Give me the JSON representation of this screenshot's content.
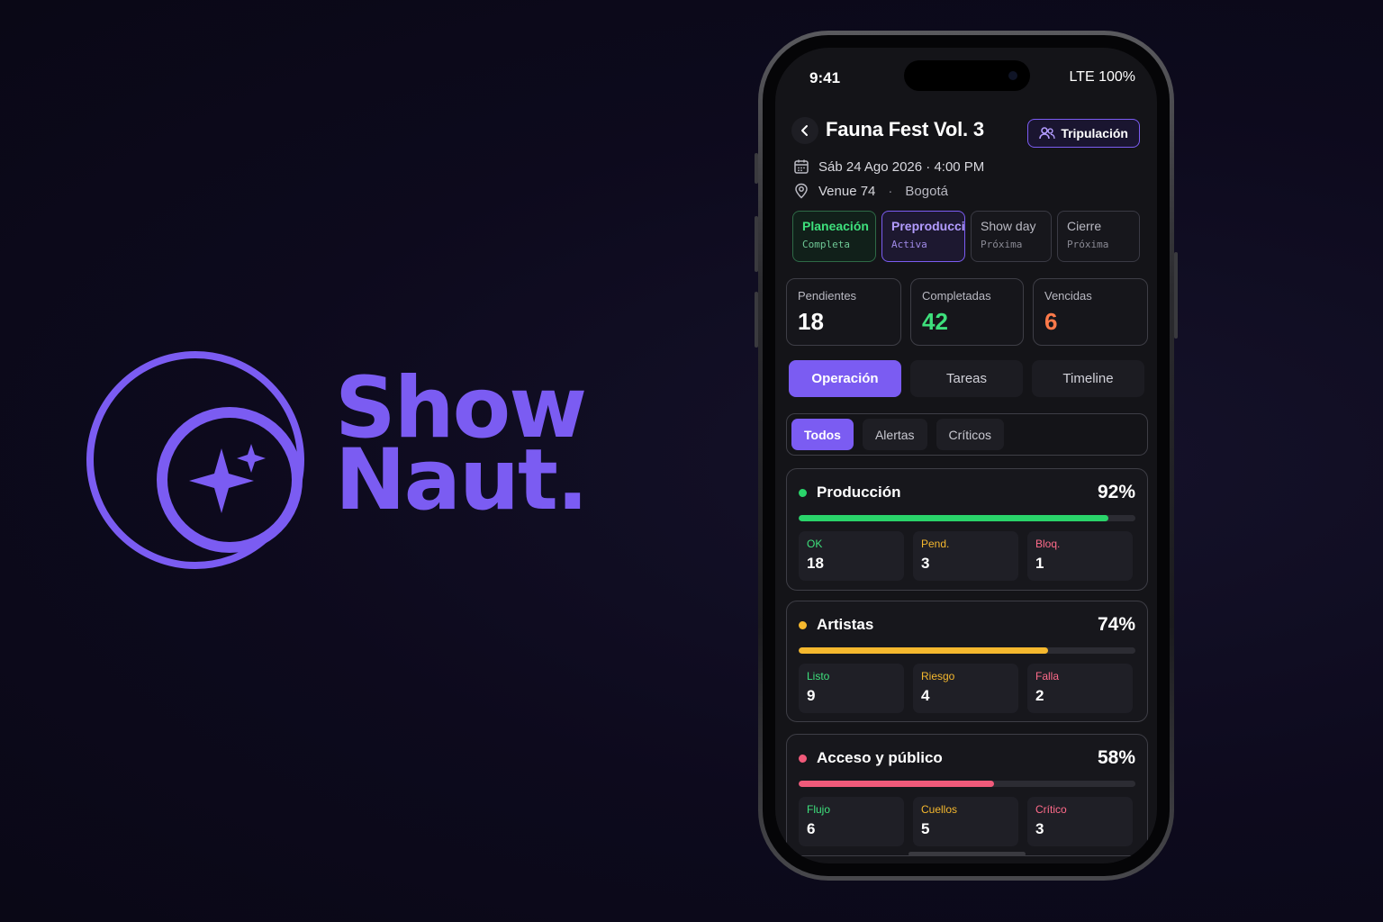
{
  "brand": {
    "line1": "Show",
    "line2": "Naut.",
    "color": "#7b5cf2"
  },
  "status_bar": {
    "time": "9:41",
    "right": "LTE 100%"
  },
  "header": {
    "title": "Fauna Fest Vol. 3",
    "crew_button": "Tripulación",
    "date": "Sáb 24 Ago 2026 · 4:00 PM",
    "venue": "Venue 74",
    "city": "Bogotá",
    "separator": "·"
  },
  "phases": [
    {
      "name": "Planeación",
      "state": "Completa"
    },
    {
      "name": "Preproducción",
      "state": "Activa"
    },
    {
      "name": "Show day",
      "state": "Próxima"
    },
    {
      "name": "Cierre",
      "state": "Próxima"
    }
  ],
  "stats": [
    {
      "label": "Pendientes",
      "value": "18",
      "color": "#ffffff"
    },
    {
      "label": "Completadas",
      "value": "42",
      "color": "#3ee07c"
    },
    {
      "label": "Vencidas",
      "value": "6",
      "color": "#ff7a4a"
    }
  ],
  "tabs": [
    "Operación",
    "Tareas",
    "Timeline"
  ],
  "filters": [
    "Todos",
    "Alertas",
    "Críticos"
  ],
  "categories": [
    {
      "name": "Producción",
      "percent": "92%",
      "progress": 0.92,
      "color": "#2ad46a",
      "metrics": [
        {
          "label": "OK",
          "value": "18",
          "color": "#3ee07c"
        },
        {
          "label": "Pend.",
          "value": "3",
          "color": "#f5b82e"
        },
        {
          "label": "Bloq.",
          "value": "1",
          "color": "#ff6b8a"
        }
      ]
    },
    {
      "name": "Artistas",
      "percent": "74%",
      "progress": 0.74,
      "color": "#f5b82e",
      "metrics": [
        {
          "label": "Listo",
          "value": "9",
          "color": "#3ee07c"
        },
        {
          "label": "Riesgo",
          "value": "4",
          "color": "#f5b82e"
        },
        {
          "label": "Falla",
          "value": "2",
          "color": "#ff6b8a"
        }
      ]
    },
    {
      "name": "Acceso y público",
      "percent": "58%",
      "progress": 0.58,
      "color": "#f05a7a",
      "metrics": [
        {
          "label": "Flujo",
          "value": "6",
          "color": "#3ee07c"
        },
        {
          "label": "Cuellos",
          "value": "5",
          "color": "#f5b82e"
        },
        {
          "label": "Crítico",
          "value": "3",
          "color": "#ff6b8a"
        }
      ]
    }
  ]
}
